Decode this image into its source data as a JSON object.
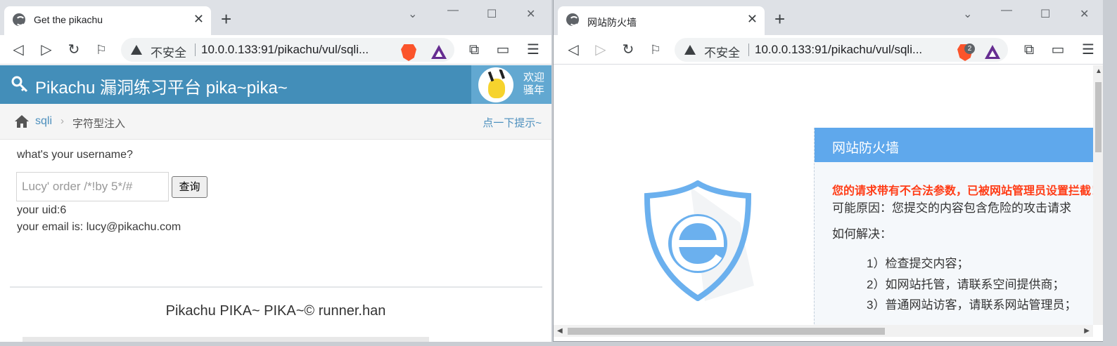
{
  "left_window": {
    "tab_title": "Get the pikachu",
    "tab_close": "✕",
    "new_tab": "+",
    "insecure_label": "不安全",
    "url": "10.0.0.133:91/pikachu/vul/sqli...",
    "page": {
      "site_title": "Pikachu 漏洞练习平台 pika~pika~",
      "welcome": "欢迎骚年",
      "breadcrumb": {
        "section": "sqli",
        "current": "字符型注入",
        "separator": "›"
      },
      "hint_link": "点一下提示~",
      "prompt": "what's your username?",
      "input_value": "Lucy' order /*!by 5*/#",
      "submit_label": "查询",
      "result_uid": "your uid:6",
      "result_email": "your email is: lucy@pikachu.com",
      "footer": "Pikachu PIKA~ PIKA~© runner.han"
    }
  },
  "right_window": {
    "tab_title": "网站防火墙",
    "tab_close": "✕",
    "new_tab": "+",
    "insecure_label": "不安全",
    "url": "10.0.0.133:91/pikachu/vul/sqli...",
    "shield_badge_count": "2",
    "page": {
      "panel_title": "网站防火墙",
      "warning": "您的请求带有不合法参数，已被网站管理员设置拦截！",
      "reason": "可能原因：您提交的内容包含危险的攻击请求",
      "how_to": "如何解决：",
      "steps": [
        "1）检查提交内容；",
        "2）如网站托管，请联系空间提供商；",
        "3）普通网站访客，请联系网站管理员；"
      ]
    }
  },
  "colors": {
    "pikachu_header": "#438eb9",
    "firewall_panel": "#5fa8ec",
    "firewall_warning": "#ff3c16"
  }
}
